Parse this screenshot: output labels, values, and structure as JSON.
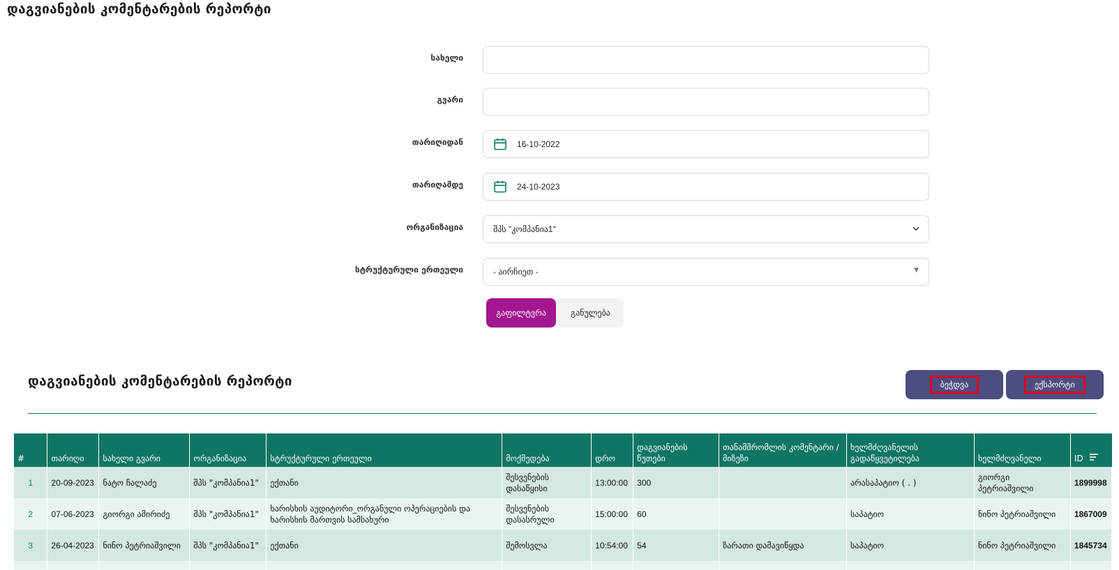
{
  "page": {
    "title": "დაგვიანების კომენტარების რეპორტი"
  },
  "form": {
    "first_name": {
      "label": "სახელი",
      "value": ""
    },
    "last_name": {
      "label": "გვარი",
      "value": ""
    },
    "date_from": {
      "label": "თარიღიდან",
      "value": "16-10-2022",
      "icon": "calendar-icon"
    },
    "date_to": {
      "label": "თარიღამდე",
      "value": "24-10-2023",
      "icon": "calendar-icon"
    },
    "organization": {
      "label": "ორგანიზაცია",
      "value": "შპს \"კომპანია1\"",
      "icon": "chevron-down-icon"
    },
    "unit": {
      "label": "სტრუქტურული ერთეული",
      "value": "- აირჩიეთ -",
      "icon": "caret-down-icon"
    },
    "filter_label": "გაფილტვრა",
    "reset_label": "განულება"
  },
  "report": {
    "title": "დაგვიანების კომენტარების რეპორტი",
    "print_label": "ბეჭდვა",
    "export_label": "ექსპორტი"
  },
  "table": {
    "columns": [
      "#",
      "თარიღი",
      "სახელი გვარი",
      "ორგანიზაცია",
      "სტრუქტურული ერთეული",
      "მოქმედება",
      "დრო",
      "დაგვიანების წუთები",
      "თანამშრომლის კომენტარი / მიზეზი",
      "ხელმძღვანელის გადაწყვეტილება",
      "ხელმძღვანელი",
      "ID"
    ],
    "sort_icon": "sort-lines-icon",
    "rows": [
      [
        "1",
        "20-09-2023",
        "ნატო ჩალაძე",
        "შპს \"კომპანია1\"",
        "ექთანი",
        "შესვენების დასაწყისი",
        "13:00:00",
        "300",
        "",
        "არასაპატიო ( . )",
        "გიორგი პეტრიაშვილი",
        "1899998"
      ],
      [
        "2",
        "07-06-2023",
        "გიორგი ამირიძე",
        "შპს \"კომპანია1\"",
        "ხარისხის აუდიტორი_ორგანული ოპერაციების და ხარისხის მართვის სამსახური",
        "შესვენების დასასრული",
        "15:00:00",
        "60",
        "",
        "საპატიო",
        "ნინო პეტრიაშვილი",
        "1867009"
      ],
      [
        "3",
        "26-04-2023",
        "ნინო პეტრიაშვილი",
        "შპს \"კომპანია1\"",
        "ექთანი",
        "შემოსვლა",
        "10:54:00",
        "54",
        "ზარათი დამავიწყდა",
        "საპატიო",
        "ნინო პეტრიაშვილი",
        "1845734"
      ],
      [
        "",
        "",
        "",
        "",
        "",
        "",
        "",
        "",
        "",
        "",
        "",
        ""
      ]
    ]
  },
  "colors": {
    "accent": "#0f7565",
    "filter": "#a3168f",
    "action": "#4d4d7f",
    "highlight": "#e0001a"
  }
}
